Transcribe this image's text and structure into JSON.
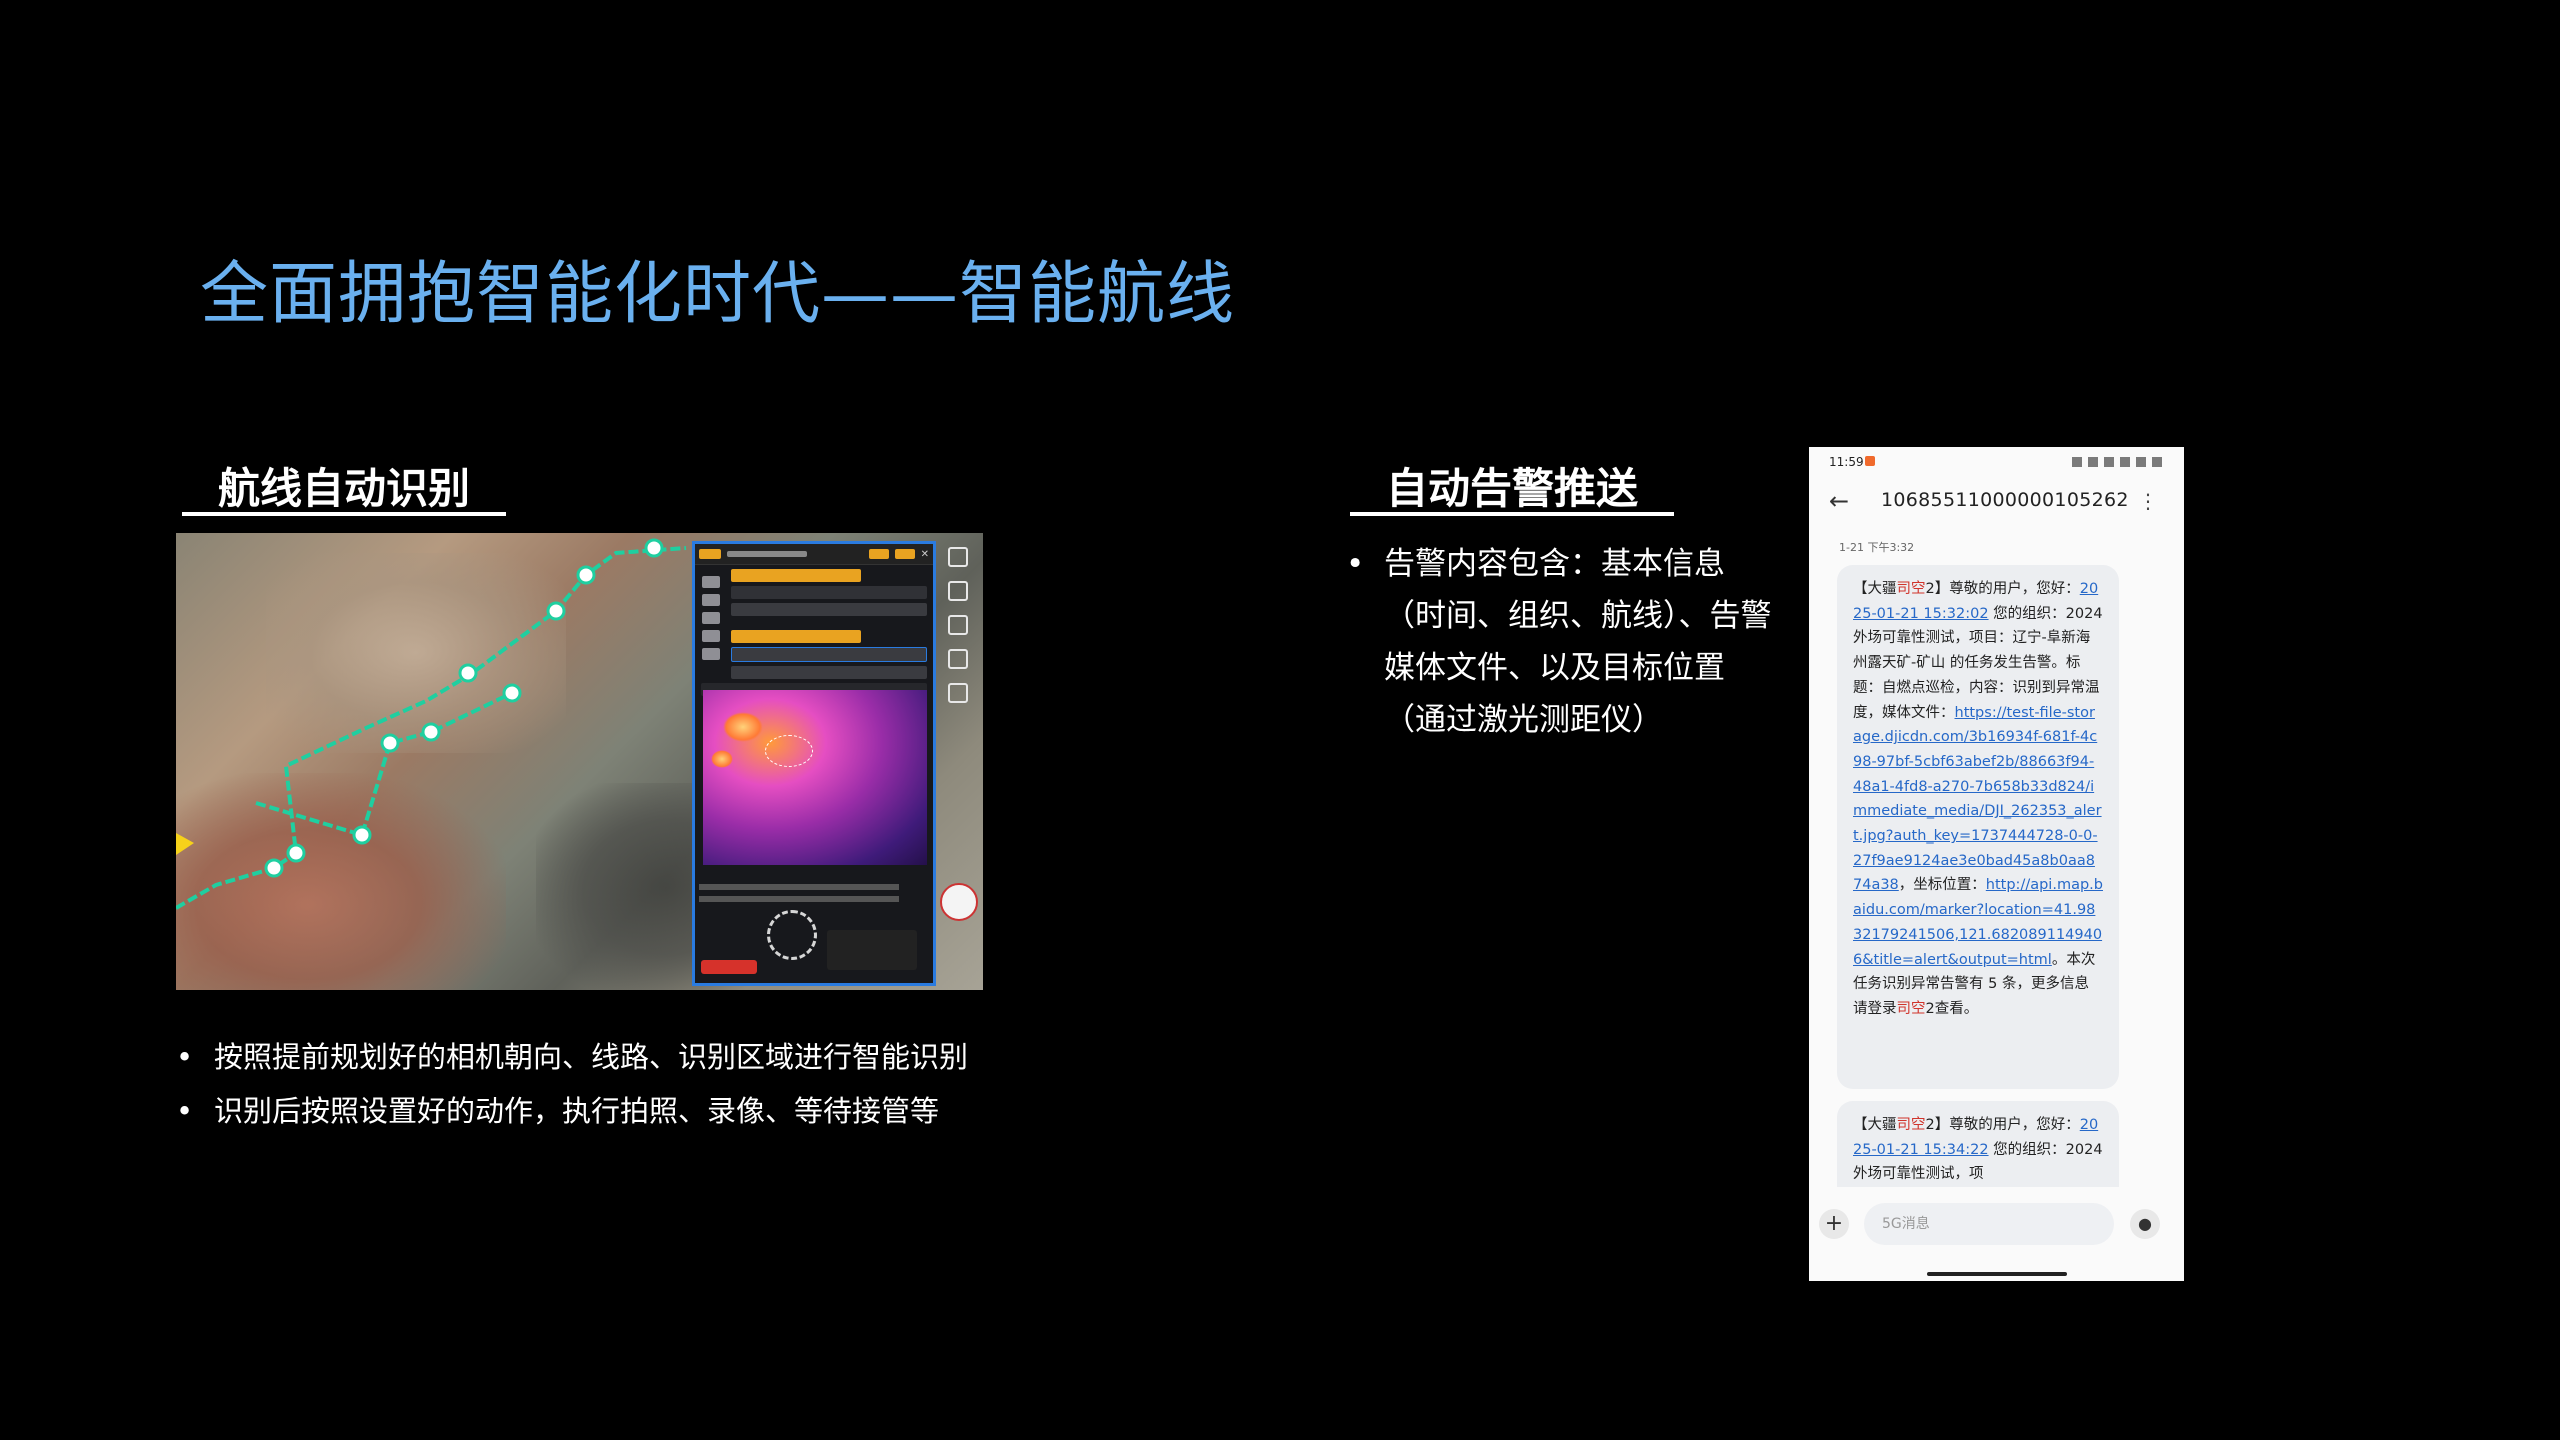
{
  "slide": {
    "title": "全面拥抱智能化时代——智能航线",
    "left": {
      "heading": "航线自动识别",
      "bullets": [
        "按照提前规划好的相机朝向、线路、识别区域进行智能识别",
        "识别后按照设置好的动作，执行拍照、录像、等待接管等"
      ]
    },
    "right": {
      "heading": "自动告警推送",
      "bullets": [
        "告警内容包含：基本信息（时间、组织、航线）、告警媒体文件、以及目标位置（通过激光测距仪）"
      ]
    }
  },
  "phone": {
    "status_time": "11:59",
    "sender_number": "10685511000000105262",
    "timestamp": "1-21 下午3:32",
    "message1": {
      "p1": "【大疆",
      "brand": "司空",
      "p2": "2】尊敬的用户，您好：",
      "link_time": "2025-01-21 15:32:02",
      "p3": " 您的组织：2024 外场可靠性测试，项目：辽宁-阜新海州露天矿-矿山 的任务发生告警。标题：自燃点巡检，内容：识别到异常温度，媒体文件：",
      "media_url": "https://test-file-storage.djicdn.com/3b16934f-681f-4c98-97bf-5cbf63abef2b/88663f94-48a1-4fd8-a270-7b658b33d824/immediate_media/DJI_262353_alert.jpg?auth_key=1737444728-0-0-27f9ae9124ae3e0bad45a8b0aa874a38",
      "p4": "，坐标位置：",
      "map_url": "http://api.map.baidu.com/marker?location=41.9832179241506,121.6820891149406&title=alert&output=html",
      "p5": "。本次任务识别异常告警有 5 条，更多信息请登录",
      "brand2": "司空",
      "p6": "2查看。"
    },
    "message2": {
      "p1": "【大疆",
      "brand": "司空",
      "p2": "2】尊敬的用户，您好：",
      "link_time": "2025-01-21 15:34:22",
      "p3": " 您的组织：2024 外场可靠性测试，项"
    },
    "input_placeholder": "5G消息"
  },
  "colors": {
    "title": "#6ab0ef",
    "route": "#1fcfa0",
    "panel_border": "#2a7be0",
    "link": "#2668c8",
    "brand": "#d0342c"
  }
}
